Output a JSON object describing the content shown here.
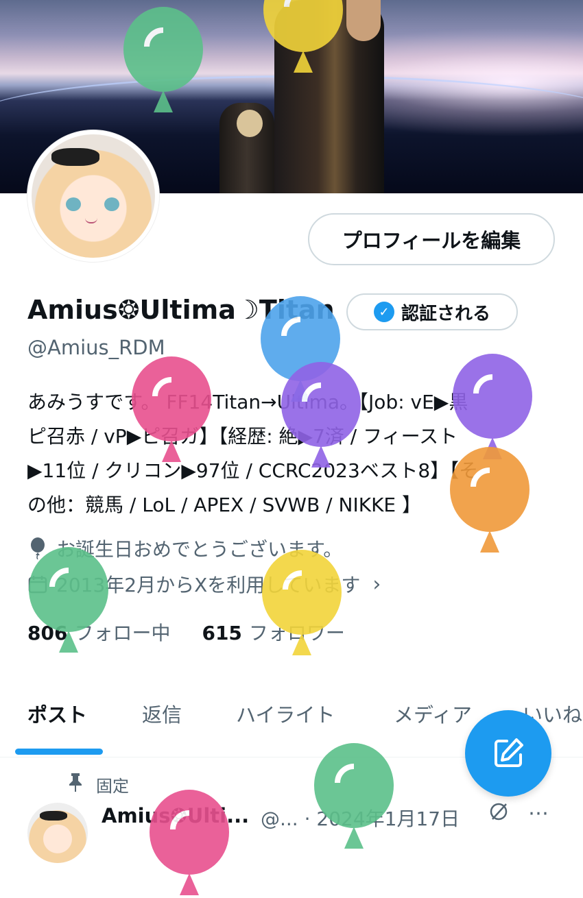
{
  "profile": {
    "edit_button": "プロフィールを編集",
    "display_name": "Amius❂Ultima☽Titan",
    "verify_button": "認証される",
    "handle": "@Amius_RDM",
    "bio_lines": [
      "あみうすです。 FF14Titan→Ultima。【Job: vE▶黒",
      "ピ召赤 / vP▶ピ召ガ】【経歴: 絶▶7済 / フィースト",
      "▶11位 / クリコン▶97位 / CCRC2023ベスト8】【そ",
      "の他：競馬 / LoL / APEX / SVWB / NIKKE 】"
    ],
    "birthday": "お誕生日おめでとうございます。",
    "joined": "2013年2月からXを利用しています",
    "following_count": "806",
    "following_label": "フォロー中",
    "followers_count": "615",
    "followers_label": "フォロワー"
  },
  "tabs": [
    "ポスト",
    "返信",
    "ハイライト",
    "メディア",
    "いいね"
  ],
  "pinned_label": "固定",
  "post": {
    "name": "Amius❂Ulti...",
    "meta": "@... · 2024年1月17日"
  },
  "colors": {
    "accent": "#1d9bf0",
    "balloon_green": "#5cc08a",
    "balloon_yellow": "#f2d43a",
    "balloon_blue": "#4ea4ec",
    "balloon_pink": "#e8508f",
    "balloon_purple": "#9063e6",
    "balloon_orange": "#f09a3a"
  }
}
